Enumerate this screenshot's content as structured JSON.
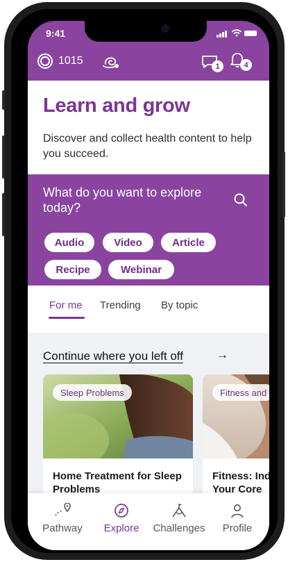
{
  "status_bar": {
    "time": "9:41"
  },
  "header": {
    "points": "1015",
    "messages_badge": "1",
    "notifications_badge": "4"
  },
  "hero": {
    "title": "Learn and grow",
    "subtitle": "Discover and collect health content to help you succeed."
  },
  "explore": {
    "question": "What do you want to explore today?",
    "chips": [
      "Audio",
      "Video",
      "Article",
      "Recipe",
      "Webinar"
    ]
  },
  "tabs": [
    {
      "label": "For me",
      "active": true
    },
    {
      "label": "Trending",
      "active": false
    },
    {
      "label": "By topic",
      "active": false
    }
  ],
  "continue_section": {
    "heading": "Continue where you left off",
    "arrow": "→",
    "cards": [
      {
        "tag": "Sleep Problems",
        "title": "Home Treatment for Sleep Problems"
      },
      {
        "tag": "Fitness and",
        "title": "Fitness: Ind Your Core"
      }
    ]
  },
  "bottom_nav": [
    {
      "label": "Pathway",
      "icon": "pathway-icon",
      "active": false
    },
    {
      "label": "Explore",
      "icon": "compass-icon",
      "active": true
    },
    {
      "label": "Challenges",
      "icon": "mountain-flag-icon",
      "active": false
    },
    {
      "label": "Profile",
      "icon": "person-icon",
      "active": false
    }
  ],
  "colors": {
    "brand_purple": "#8a44a0",
    "title_purple": "#7b3595",
    "background_gray": "#eff1f4"
  }
}
